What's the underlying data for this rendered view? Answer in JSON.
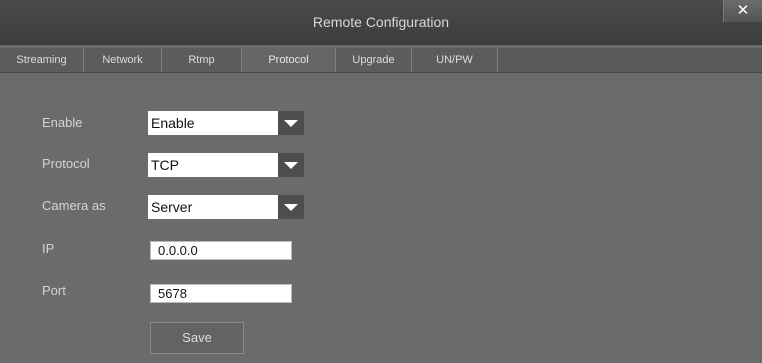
{
  "window": {
    "title": "Remote Configuration",
    "close_glyph": "✕"
  },
  "tabs": [
    {
      "label": "Streaming"
    },
    {
      "label": "Network"
    },
    {
      "label": "Rtmp"
    },
    {
      "label": "Protocol",
      "active": true
    },
    {
      "label": "Upgrade"
    },
    {
      "label": "UN/PW"
    }
  ],
  "form": {
    "enable": {
      "label": "Enable",
      "value": "Enable"
    },
    "protocol": {
      "label": "Protocol",
      "value": "TCP"
    },
    "camera_as": {
      "label": "Camera as",
      "value": "Server"
    },
    "ip": {
      "label": "IP",
      "value": "0.0.0.0"
    },
    "port": {
      "label": "Port",
      "value": "5678"
    }
  },
  "actions": {
    "save_label": "Save"
  },
  "icons": {
    "close": "close-icon",
    "dropdown": "triangle-down-icon"
  },
  "colors": {
    "background": "#6b6b6b",
    "titlebar": "#404040",
    "arrow_box": "#4e4e4e",
    "text": "#d4d4d4"
  }
}
